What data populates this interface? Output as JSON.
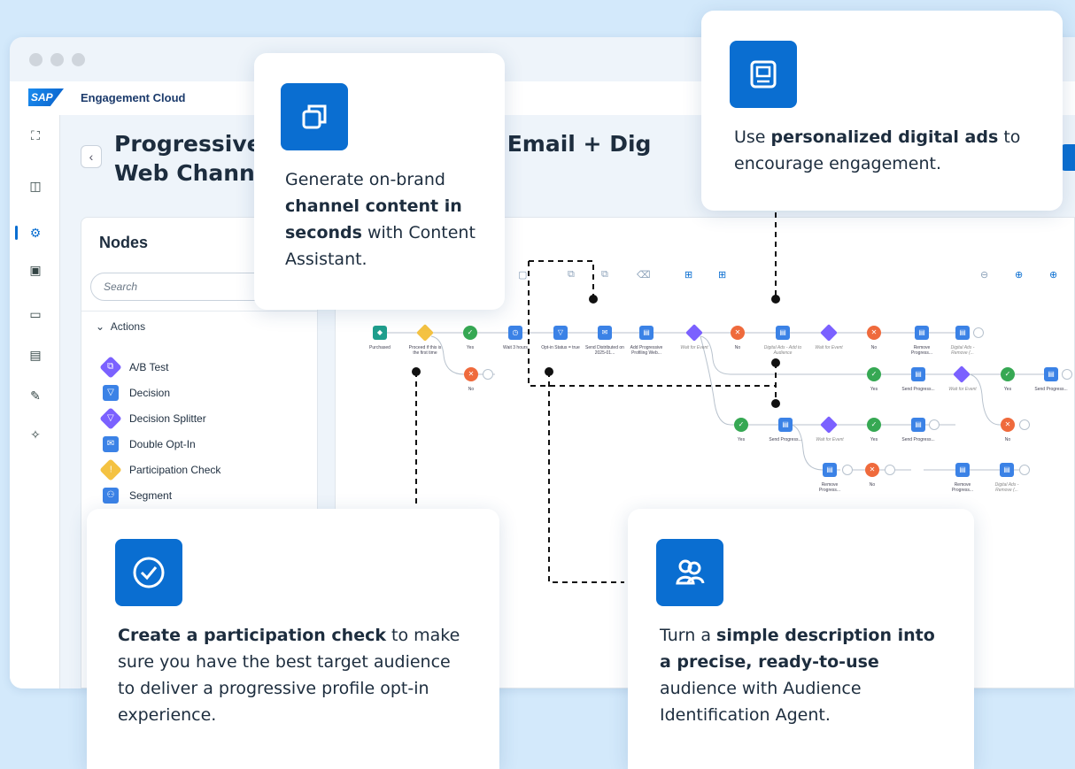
{
  "app": {
    "logo": "SAP",
    "name": "Engagement Cloud"
  },
  "page": {
    "title_line1": "Progressive",
    "title_mid": "nber) Email + Dig",
    "title_line2": "Web Chann"
  },
  "nodes_panel": {
    "title": "Nodes",
    "search_placeholder": "Search",
    "section": "Actions",
    "items": [
      {
        "label": "A/B Test",
        "icon": "ab-test-icon",
        "color": "#7b61ff"
      },
      {
        "label": "Decision",
        "icon": "decision-icon",
        "color": "#3b82e6"
      },
      {
        "label": "Decision Splitter",
        "icon": "decision-splitter-icon",
        "color": "#7b61ff"
      },
      {
        "label": "Double Opt-In",
        "icon": "double-opt-in-icon",
        "color": "#3b82e6"
      },
      {
        "label": "Participation Check",
        "icon": "participation-check-icon",
        "color": "#f4c242"
      },
      {
        "label": "Segment",
        "icon": "segment-icon",
        "color": "#3b82e6"
      }
    ]
  },
  "flow": {
    "labels": {
      "purchased": "Purchased",
      "proceed": "Proceed if this is the first time",
      "yes": "Yes",
      "no": "No",
      "wait": "Wait 3 hours",
      "optin": "Opt-in Status = true",
      "send_distributed": "Send Distributed on 2025-01...",
      "add_progressive": "Add Progressive Profiling Web...",
      "wait_event": "Wait for Event",
      "digital_add": "Digital Ads - Add to Audience",
      "remove_progress": "Remove Progress...",
      "digital_remove": "Digital Ads - Remove (...",
      "send_progress": "Send Progress..."
    }
  },
  "cards": {
    "content": {
      "pre": "Generate on-brand ",
      "bold": "channel content in seconds",
      "post": " with Content Assistant."
    },
    "ads": {
      "pre": "Use ",
      "bold": "personalized digital ads",
      "post": " to encourage engagement."
    },
    "participation": {
      "bold": "Create a participation check",
      "post": " to make sure you have the best target audience to deliver a progressive profile opt-in experience."
    },
    "audience": {
      "pre": "Turn a ",
      "bold": "simple description into a precise, ready-to-use",
      "post": " audience with Audience Identification Agent."
    }
  },
  "colors": {
    "accent": "#0a6ed1",
    "background": "#d3e9fb"
  }
}
